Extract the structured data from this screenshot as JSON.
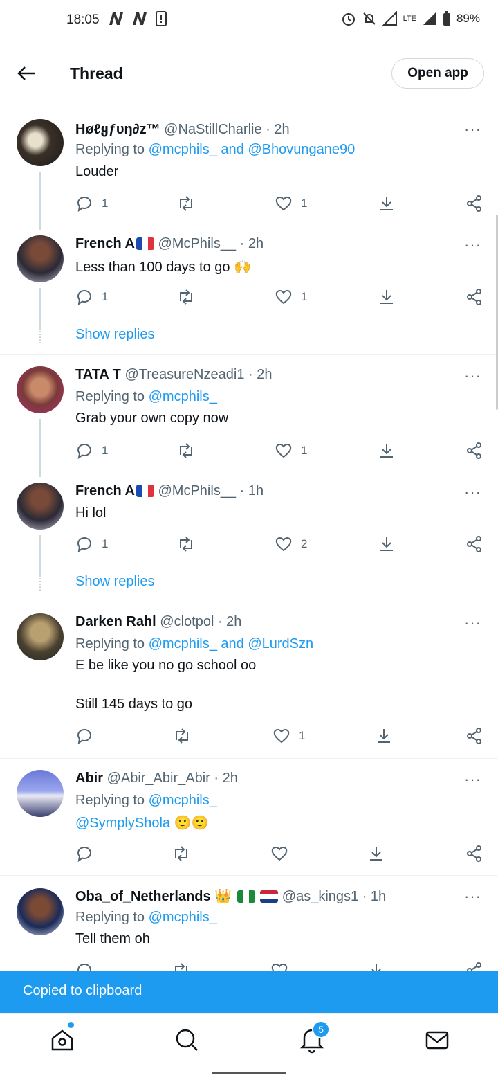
{
  "status_bar": {
    "time": "18:05",
    "battery": "89%",
    "network": "LTE"
  },
  "header": {
    "title": "Thread",
    "open_app": "Open app"
  },
  "tweets": [
    {
      "name": "Høℓყƒυŋ∂z™",
      "handle": "@NaStillCharlie",
      "time": "· 2h",
      "replying_label": "Replying to",
      "replying": "@mcphils_ and @Bhovungane90",
      "text": "Louder",
      "replies": "1",
      "likes": "1"
    },
    {
      "name": "French A",
      "handle": "@McPhils__",
      "time": "· 2h",
      "text": "Less than 100 days to go",
      "emoji": "🙌",
      "replies": "1",
      "likes": "1",
      "show_replies": "Show replies"
    },
    {
      "name": "TATA T",
      "handle": "@TreasureNzeadi1",
      "time": "· 2h",
      "replying_label": "Replying to",
      "replying": "@mcphils_",
      "text": "Grab your own copy now",
      "replies": "1",
      "likes": "1"
    },
    {
      "name": "French A",
      "handle": "@McPhils__",
      "time": "· 1h",
      "text": "Hi lol",
      "replies": "1",
      "likes": "2",
      "show_replies": "Show replies"
    },
    {
      "name": "Darken Rahl",
      "handle": "@clotpol",
      "time": "· 2h",
      "replying_label": "Replying to",
      "replying": "@mcphils_ and @LurdSzn",
      "text": "E be like you no go school oo",
      "text2": "Still 145 days to go",
      "likes": "1"
    },
    {
      "name": "Abir",
      "handle": "@Abir_Abir_Abir",
      "time": "· 2h",
      "replying_label": "Replying to",
      "replying": "@mcphils_",
      "mention": "@SymplyShola",
      "emoji": "🙂🙂"
    },
    {
      "name": "Oba_of_Netherlands",
      "handle": "@as_kings1",
      "time": "· 1h",
      "replying_label": "Replying to",
      "replying": "@mcphils_",
      "text": "Tell them oh",
      "emoji": "👑"
    }
  ],
  "toast": "Copied to clipboard",
  "nav": {
    "notifications_badge": "5"
  },
  "colors": {
    "accent": "#1d9bf0",
    "text": "#0f1419",
    "secondary": "#536471"
  },
  "more_glyph": "···"
}
